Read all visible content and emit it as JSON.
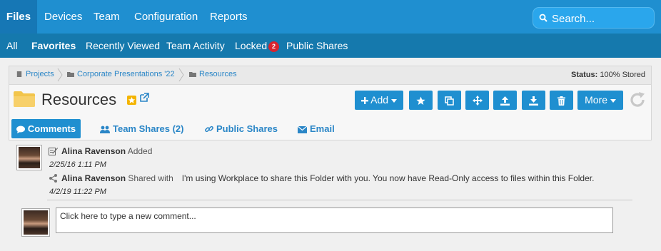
{
  "topnav": {
    "tabs": [
      "Files",
      "Devices",
      "Team",
      "Configuration",
      "Reports"
    ],
    "search_placeholder": "Search..."
  },
  "subnav": {
    "items": [
      "All",
      "Favorites",
      "Recently Viewed",
      "Team Activity",
      "Locked",
      "Public Shares"
    ],
    "locked_count": "2"
  },
  "breadcrumb": {
    "items": [
      "Projects",
      "Corporate Presentations '22",
      "Resources"
    ]
  },
  "status": {
    "label": "Status:",
    "value": "100% Stored"
  },
  "folder": {
    "title": "Resources"
  },
  "toolbar": {
    "add_label": "Add",
    "more_label": "More"
  },
  "tabs": [
    "Comments",
    "Team Shares (2)",
    "Public Shares",
    "Email"
  ],
  "activity": [
    {
      "user": "Alina Ravenson",
      "action": "Added",
      "message": "",
      "date": "2/25/16 1:11 PM",
      "icon": "edit-icon"
    },
    {
      "user": "Alina Ravenson",
      "action": "Shared with",
      "message": "I'm using Workplace to share this Folder with you. You now have Read-Only access to files within this Folder.",
      "date": "4/2/19 11:22 PM",
      "icon": "share-icon"
    }
  ],
  "comment_input": {
    "placeholder": "Click here to type a new comment..."
  },
  "colors": {
    "nav": "#1f8fd0",
    "subnav": "#1579ad",
    "accent": "#2a86c7",
    "badge": "#d9232e",
    "star": "#f4b400"
  }
}
